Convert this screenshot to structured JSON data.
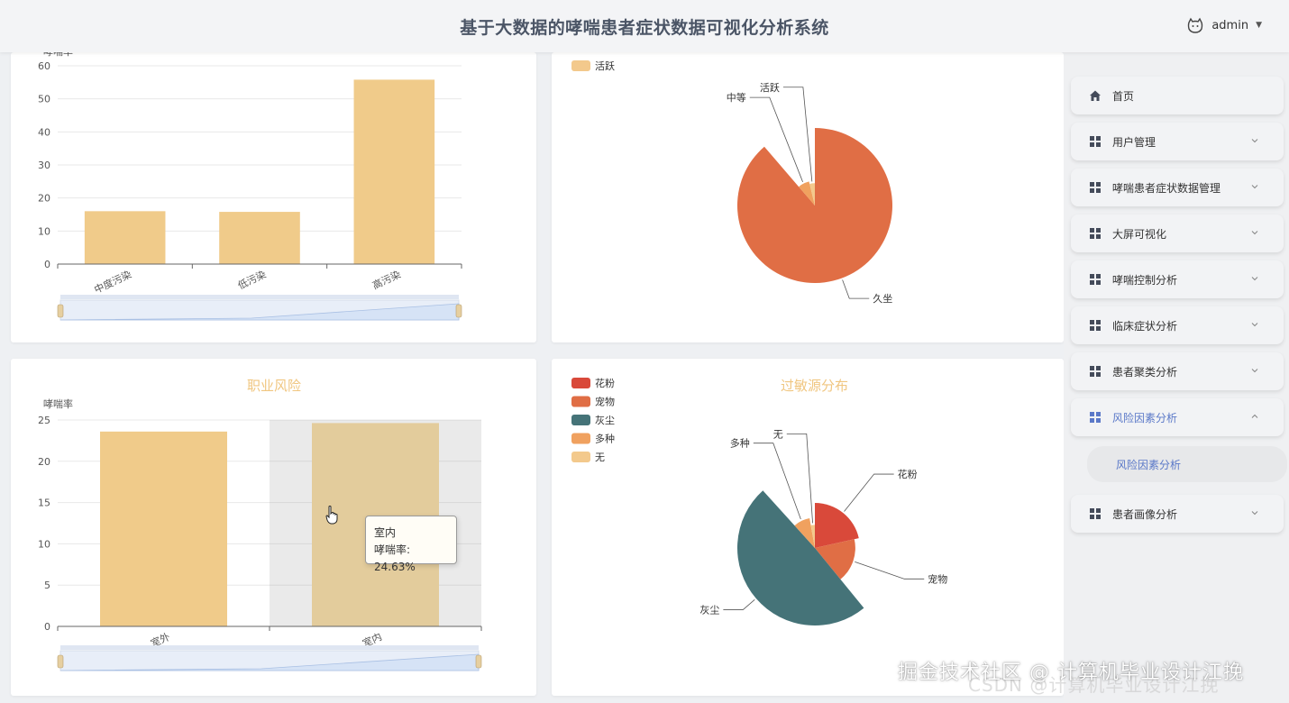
{
  "header": {
    "title": "基于大数据的哮喘患者症状数据可视化分析系统",
    "username": "admin"
  },
  "sidebar": {
    "items": [
      {
        "label": "首页",
        "icon": "home-icon"
      },
      {
        "label": "用户管理",
        "icon": "grid-icon"
      },
      {
        "label": "哮喘患者症状数据管理",
        "icon": "grid-icon"
      },
      {
        "label": "大屏可视化",
        "icon": "grid-icon"
      },
      {
        "label": "哮喘控制分析",
        "icon": "grid-icon"
      },
      {
        "label": "临床症状分析",
        "icon": "grid-icon"
      },
      {
        "label": "患者聚类分析",
        "icon": "grid-icon"
      },
      {
        "label": "风险因素分析",
        "icon": "grid-icon"
      },
      {
        "label": "患者画像分析",
        "icon": "grid-icon"
      }
    ],
    "active_sub": "风险因素分析"
  },
  "tooltip": {
    "title": "室内",
    "text": "哮喘率: 24.63%"
  },
  "watermark": {
    "main": "掘金技术社区 @ 计算机毕业设计江挽",
    "faded": "CSDN @计算机毕业设计江挽"
  },
  "colors": {
    "bar": "#f0cb8a",
    "bar_hover": "#e3cc9c",
    "accent": "#5a78c8",
    "title": "#f0c680"
  },
  "chart_data": [
    {
      "type": "bar",
      "title": "",
      "ylabel": "哮喘率",
      "categories": [
        "中度污染",
        "低污染",
        "高污染"
      ],
      "values": [
        16.0,
        15.8,
        55.8
      ],
      "ylim": [
        0,
        60
      ],
      "yticks": [
        0,
        10,
        20,
        30,
        40,
        50,
        60
      ],
      "grid": true
    },
    {
      "type": "pie",
      "title": "",
      "legend": [
        "活跃"
      ],
      "legend_position": "top-left",
      "slices": [
        {
          "name": "久坐",
          "value": 88.7,
          "color": "#e06e45"
        },
        {
          "name": "中等",
          "value": 7.5,
          "color": "#f0a15f"
        },
        {
          "name": "活跃",
          "value": 3.8,
          "color": "#f3c98c"
        }
      ]
    },
    {
      "type": "bar",
      "title": "职业风险",
      "ylabel": "哮喘率",
      "categories": [
        "室外",
        "室内"
      ],
      "values": [
        23.6,
        24.63
      ],
      "ylim": [
        0,
        25
      ],
      "yticks": [
        0,
        5,
        10,
        15,
        20,
        25
      ],
      "grid": true,
      "highlighted_index": 1
    },
    {
      "type": "pie",
      "title": "过敏源分布",
      "legend": [
        "花粉",
        "宠物",
        "灰尘",
        "多种",
        "无"
      ],
      "legend_position": "top-left",
      "slices": [
        {
          "name": "花粉",
          "value": 21.5,
          "color": "#d9493a"
        },
        {
          "name": "宠物",
          "value": 17.6,
          "color": "#e06e45"
        },
        {
          "name": "灰尘",
          "value": 49.2,
          "color": "#457378"
        },
        {
          "name": "多种",
          "value": 8.9,
          "color": "#f0a15f"
        },
        {
          "name": "无",
          "value": 2.8,
          "color": "#f3c98c"
        }
      ]
    }
  ]
}
